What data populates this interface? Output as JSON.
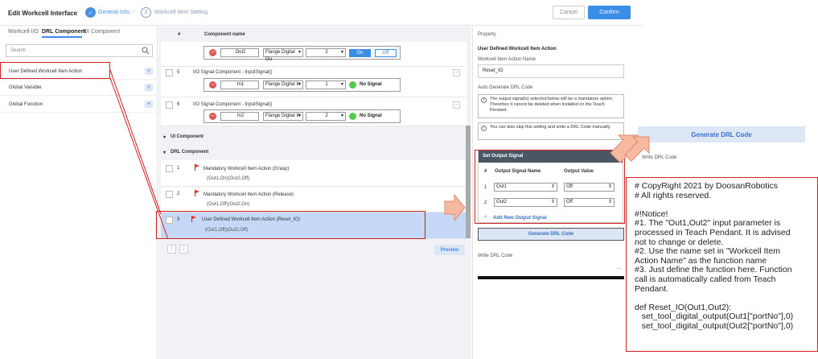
{
  "header": {
    "title": "Edit Workcell Interface",
    "step1_num": "✓",
    "step1_label": "General Info.",
    "step_dots": "···",
    "step2_num": "2",
    "step2_label": "Workcell Item Setting",
    "cancel": "Cancel",
    "confirm": "Confirm"
  },
  "left": {
    "tabs": [
      "Workcell I/O",
      "DRL Component",
      "UI Component"
    ],
    "search_placeholder": "Search",
    "items": [
      "User Defined Workcell Item Action",
      "Global Variable",
      "Global Function"
    ],
    "plus": "+"
  },
  "table": {
    "col_num": "#",
    "col_name": "Component name"
  },
  "rows": {
    "r4": {
      "port": "Out2",
      "type": "Flange Digital Ou",
      "val": "2",
      "on": "On",
      "off": "Off"
    },
    "r5": {
      "num": "5",
      "title": "I/O Signal Component - InputSignal()",
      "port": "In1",
      "type": "Flange Digital In",
      "val": "1",
      "sig": "No Signal"
    },
    "r6": {
      "num": "6",
      "title": "I/O Signal Component - InputSignal()",
      "port": "In2",
      "type": "Flange Digital In",
      "val": "2",
      "sig": "No Signal"
    }
  },
  "sections": {
    "ui": "UI Component",
    "drl": "DRL Component"
  },
  "drl_rows": [
    {
      "num": "1",
      "title": "Mandatory Workcell Item Action (Grasp)",
      "sub": "(Out1,On)(Out2,Off)"
    },
    {
      "num": "2",
      "title": "Mandatory Workcell Item Action (Release)",
      "sub": "(Out1,Off)(Out2,On)"
    },
    {
      "num": "3",
      "title": "User Defined Workcell Item Action (Reset_IO)",
      "sub": "(Out1,Off)(Out2,Off)"
    }
  ],
  "bottom": {
    "up": "↑",
    "down": "↓",
    "preview": "Preview"
  },
  "property": {
    "header": "Property",
    "section": "User Defined Workcell Item Action",
    "name_label": "Workcell Item Action Name",
    "name_value": "Reset_IO",
    "auto_label": "Auto Generate DRL Code",
    "info1": "The output signal(s) selected below will be a mandatory option. Therefore it cannot be deleted when installed on the Teach Pendant.",
    "info2": "You can also skip this setting and write a DRL Code manually.",
    "sos_title": "Set Output Signal",
    "col_num": "#",
    "col_name": "Output Signal Name",
    "col_val": "Output Value",
    "sig_rows": [
      {
        "n": "1",
        "name": "Out1",
        "val": "Off"
      },
      {
        "n": "2",
        "name": "Out2",
        "val": "Off"
      }
    ],
    "add": "Add New Output Signal",
    "gen": "Generate DRL Code",
    "write": "Write DRL Code",
    "dash": "—"
  },
  "zoom": {
    "gen": "Generate DRL Code",
    "write": "Write DRL Code"
  },
  "code": {
    "text": "# CopyRight 2021 by DoosanRobotics\n# All rights reserved.\n\n#!Notice!\n#1. The \"Out1,Out2\" input parameter is\nprocessed in Teach Pendant. It is advised\nnot to change or delete.\n#2. Use the name set in \"Workcell Item\nAction Name\" as the function name\n#3. Just define the function here. Function\ncall is automatically called from Teach\nPendant.\n\ndef Reset_IO(Out1,Out2):\n   set_tool_digital_output(Out1[\"portNo\"],0)\n   set_tool_digital_output(Out2[\"portNo\"],0)"
  },
  "colors": {
    "accent": "#3a8ee6",
    "annotation_red": "#d02020",
    "arrow": "#f7b9a0"
  }
}
